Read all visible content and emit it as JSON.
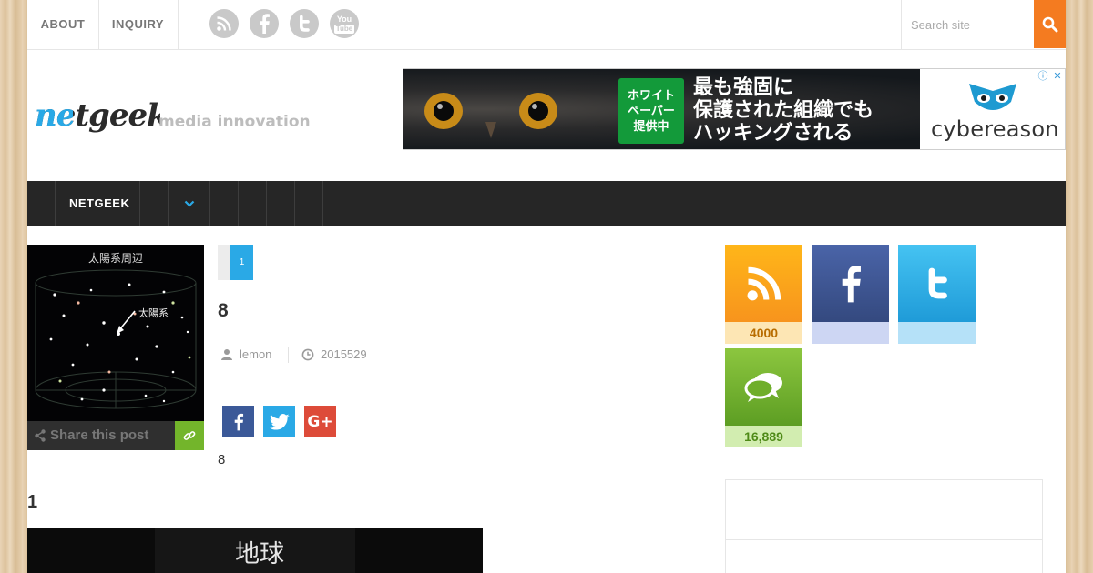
{
  "topbar": {
    "links": [
      "ABOUT",
      "INQUIRY"
    ],
    "social_icons": [
      "rss-icon",
      "facebook-icon",
      "twitter-icon",
      "youtube-icon"
    ],
    "youtube_text": [
      "You",
      "Tube"
    ],
    "search_placeholder": "Search site"
  },
  "header": {
    "logo_text": "netgeek",
    "tagline": "media innovation"
  },
  "ad": {
    "badge_lines": [
      "ホワイト",
      "ペーパー",
      "提供中"
    ],
    "headline_lines": [
      "最も強固に",
      "保護された組織でも",
      "ハッキングされる"
    ],
    "brand": "cybereason",
    "controls": [
      "ⓘ",
      "✕"
    ]
  },
  "nav": {
    "items": [
      "NETGEEK"
    ]
  },
  "post": {
    "thumb_title": "太陽系周辺",
    "thumb_arrow_label": "太陽系",
    "share_label": "Share this post",
    "page_number": "1",
    "title": "8",
    "author": "lemon",
    "date": "2015529",
    "excerpt": "8",
    "section_heading": "1",
    "image_caption": "地球"
  },
  "sidebar": {
    "tiles": [
      {
        "icon": "rss-icon",
        "count": "4000"
      },
      {
        "icon": "facebook-icon",
        "count": ""
      },
      {
        "icon": "twitter-icon",
        "count": ""
      },
      {
        "icon": "comments-icon",
        "count": "16,889"
      }
    ]
  },
  "colors": {
    "accent_orange": "#f47b20",
    "accent_blue": "#2aa9e6",
    "nav_bg": "#262626",
    "share_green": "#73b52b"
  }
}
